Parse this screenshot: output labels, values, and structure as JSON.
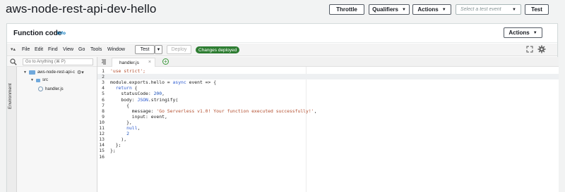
{
  "page": {
    "title": "aws-node-rest-api-dev-hello"
  },
  "header": {
    "throttle_label": "Throttle",
    "qualifiers_label": "Qualifiers",
    "actions_label": "Actions",
    "test_event_placeholder": "Select a test event",
    "test_label": "Test"
  },
  "panel": {
    "title": "Function code",
    "info_label": "Info",
    "actions_label": "Actions"
  },
  "ide": {
    "menu": [
      "File",
      "Edit",
      "Find",
      "View",
      "Go",
      "Tools",
      "Window"
    ],
    "test_label": "Test",
    "deploy_label": "Deploy",
    "status_badge": "Changes deployed"
  },
  "sidebar": {
    "search_placeholder": "Go to Anything (⌘ P)",
    "environment_label": "Environment",
    "tree": {
      "root": "aws-node-rest-api-c",
      "folder": "src",
      "file": "handler.js"
    }
  },
  "editor": {
    "tab_label": "handler.js",
    "active_line": 2,
    "lines": [
      {
        "n": "1",
        "t": [
          {
            "c": "str",
            "v": "'use strict';"
          }
        ]
      },
      {
        "n": "2",
        "t": []
      },
      {
        "n": "3",
        "t": [
          {
            "c": "",
            "v": "module.exports.hello = "
          },
          {
            "c": "kw",
            "v": "async"
          },
          {
            "c": "",
            "v": " event => {"
          }
        ]
      },
      {
        "n": "4",
        "t": [
          {
            "c": "",
            "v": "  "
          },
          {
            "c": "kw",
            "v": "return"
          },
          {
            "c": "",
            "v": " {"
          }
        ]
      },
      {
        "n": "5",
        "t": [
          {
            "c": "",
            "v": "    statusCode: "
          },
          {
            "c": "num",
            "v": "200"
          },
          {
            "c": "",
            "v": ","
          }
        ]
      },
      {
        "n": "6",
        "t": [
          {
            "c": "",
            "v": "    body: "
          },
          {
            "c": "kw",
            "v": "JSON"
          },
          {
            "c": "",
            "v": ".stringify("
          }
        ]
      },
      {
        "n": "7",
        "t": [
          {
            "c": "",
            "v": "      {"
          }
        ]
      },
      {
        "n": "8",
        "t": [
          {
            "c": "",
            "v": "        message: "
          },
          {
            "c": "str",
            "v": "'Go Serverless v1.0! Your function executed successfully!'"
          },
          {
            "c": "",
            "v": ","
          }
        ]
      },
      {
        "n": "9",
        "t": [
          {
            "c": "",
            "v": "        input: event,"
          }
        ]
      },
      {
        "n": "10",
        "t": [
          {
            "c": "",
            "v": "      },"
          }
        ]
      },
      {
        "n": "11",
        "t": [
          {
            "c": "",
            "v": "      "
          },
          {
            "c": "kw",
            "v": "null"
          },
          {
            "c": "",
            "v": ","
          }
        ]
      },
      {
        "n": "12",
        "t": [
          {
            "c": "",
            "v": "      "
          },
          {
            "c": "num",
            "v": "2"
          }
        ]
      },
      {
        "n": "13",
        "t": [
          {
            "c": "",
            "v": "    ),"
          }
        ]
      },
      {
        "n": "14",
        "t": [
          {
            "c": "",
            "v": "  };"
          }
        ]
      },
      {
        "n": "15",
        "t": [
          {
            "c": "",
            "v": "};"
          }
        ]
      },
      {
        "n": "16",
        "t": []
      }
    ]
  }
}
